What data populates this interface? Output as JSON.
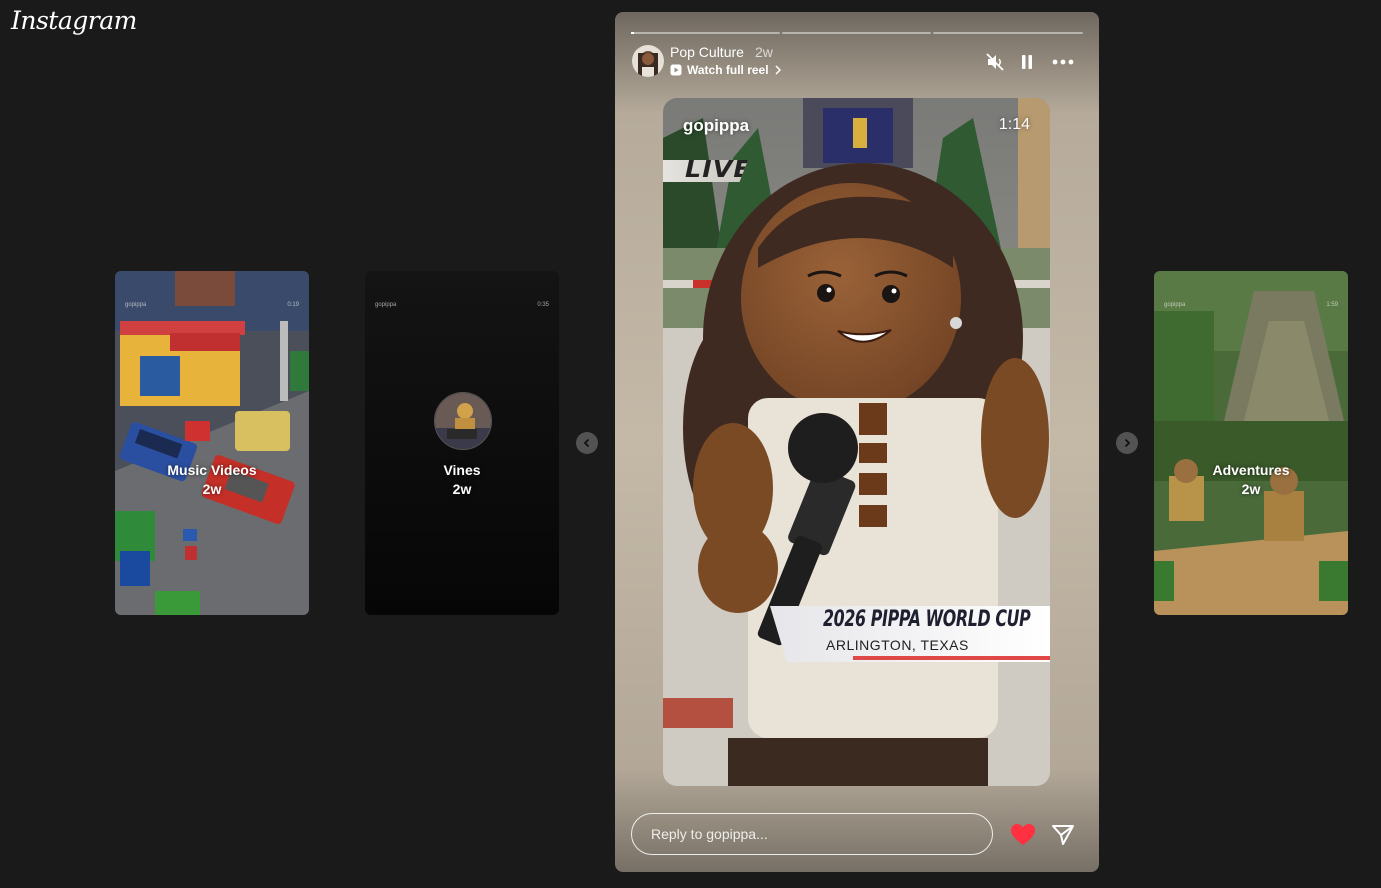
{
  "app": {
    "logo": "Instagram"
  },
  "stories": [
    {
      "title": "Music Videos",
      "time": "2w",
      "user_small": "gopippa",
      "duration_small": "0:19"
    },
    {
      "title": "Vines",
      "time": "2w",
      "user_small": "gopippa",
      "duration_small": "0:35"
    },
    {
      "title": "Adventures",
      "time": "2w",
      "user_small": "gopippa",
      "duration_small": "1:59"
    }
  ],
  "active": {
    "name": "Pop Culture",
    "age": "2w",
    "watch_full": "Watch full reel",
    "video_user": "gopippa",
    "video_duration": "1:14",
    "live_badge": "LIVE",
    "lower_third_title": "2026 PIPPA WORLD CUP",
    "lower_third_sub": "ARLINGTON, TEXAS",
    "reply_placeholder": "Reply to gopippa...",
    "progress": 0.01
  },
  "colors": {
    "background": "#1a1a1a",
    "heart": "#ff3040"
  },
  "icons": [
    "mute-icon",
    "pause-icon",
    "more-icon",
    "heart-icon",
    "send-icon",
    "play-icon",
    "chevron-right-icon",
    "chevron-left-icon"
  ]
}
